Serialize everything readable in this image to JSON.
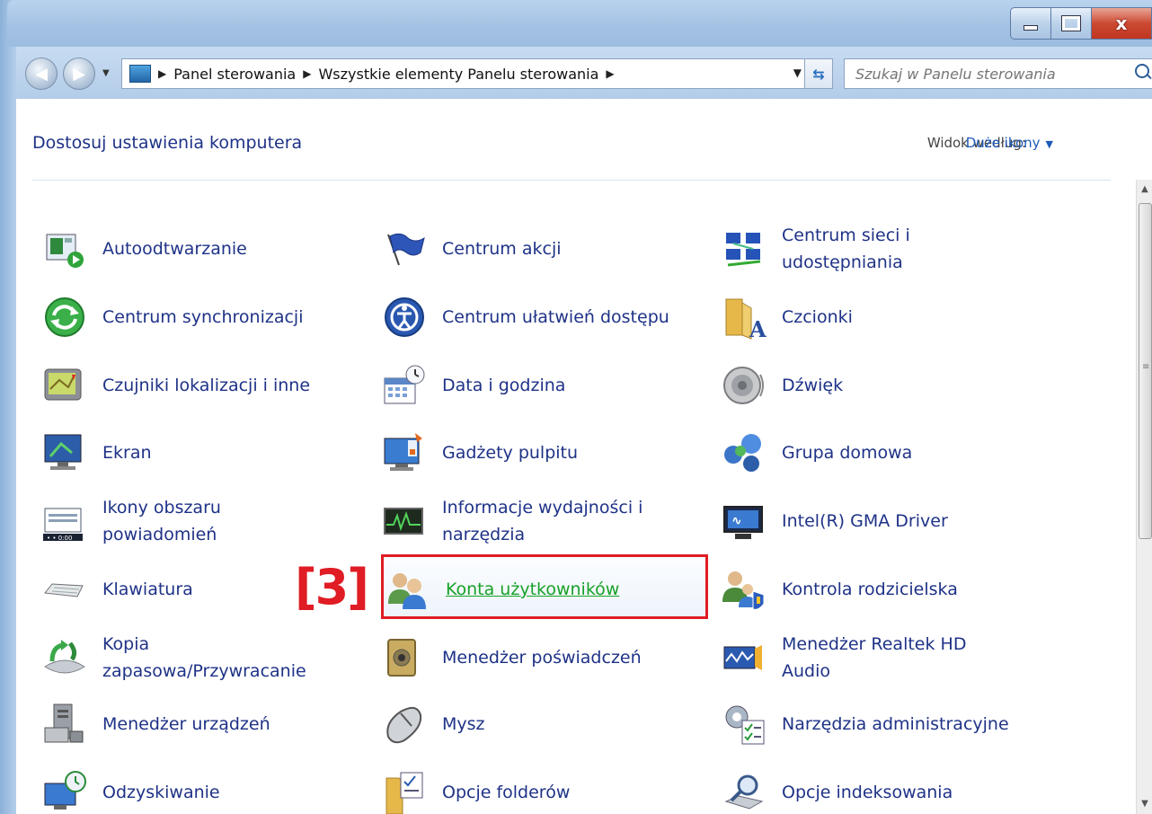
{
  "window": {
    "buttons": {
      "minimize": "–",
      "maximize": "□",
      "close": "x"
    }
  },
  "nav": {
    "back": "◀",
    "forward": "▶",
    "breadcrumb": [
      "Panel sterowania",
      "Wszystkie elementy Panelu sterowania"
    ],
    "search_placeholder": "Szukaj w Panelu sterowania"
  },
  "header": {
    "title": "Dostosuj ustawienia komputera",
    "view_by_label": "Widok według:",
    "view_by_value": "Duże ikony"
  },
  "annotation": {
    "tag": "[3]",
    "color": "#e01c24"
  },
  "items": [
    {
      "label": "Autoodtwarzanie",
      "icon": "autoplay-icon"
    },
    {
      "label": "Centrum akcji",
      "icon": "action-center-flag-icon"
    },
    {
      "label": "Centrum sieci i udostępniania",
      "icon": "network-center-icon"
    },
    {
      "label": "Centrum synchronizacji",
      "icon": "sync-center-icon"
    },
    {
      "label": "Centrum ułatwień dostępu",
      "icon": "ease-of-access-icon"
    },
    {
      "label": "Czcionki",
      "icon": "fonts-folder-icon"
    },
    {
      "label": "Czujniki lokalizacji i inne",
      "icon": "location-sensors-icon"
    },
    {
      "label": "Data i godzina",
      "icon": "date-time-icon"
    },
    {
      "label": "Dźwięk",
      "icon": "speaker-icon"
    },
    {
      "label": "Ekran",
      "icon": "display-monitor-icon"
    },
    {
      "label": "Gadżety pulpitu",
      "icon": "desktop-gadgets-icon"
    },
    {
      "label": "Grupa domowa",
      "icon": "homegroup-icon"
    },
    {
      "label": "Ikony obszaru powiadomień",
      "icon": "notification-area-icon"
    },
    {
      "label": "Informacje wydajności i narzędzia",
      "icon": "performance-icon"
    },
    {
      "label": "Intel(R) GMA Driver",
      "icon": "intel-gma-icon"
    },
    {
      "label": "Klawiatura",
      "icon": "keyboard-icon"
    },
    {
      "label": "Konta użytkowników",
      "icon": "user-accounts-icon"
    },
    {
      "label": "Kontrola rodzicielska",
      "icon": "parental-controls-icon"
    },
    {
      "label": "Kopia zapasowa/Przywracanie",
      "icon": "backup-restore-icon"
    },
    {
      "label": "Menedżer poświadczeń",
      "icon": "credential-manager-icon"
    },
    {
      "label": "Menedżer Realtek HD Audio",
      "icon": "realtek-audio-icon"
    },
    {
      "label": "Menedżer urządzeń",
      "icon": "device-manager-icon"
    },
    {
      "label": "Mysz",
      "icon": "mouse-icon"
    },
    {
      "label": "Narzędzia administracyjne",
      "icon": "admin-tools-icon"
    },
    {
      "label": "Odzyskiwanie",
      "icon": "recovery-icon"
    },
    {
      "label": "Opcje folderów",
      "icon": "folder-options-icon"
    },
    {
      "label": "Opcje indeksowania",
      "icon": "indexing-options-icon"
    }
  ]
}
